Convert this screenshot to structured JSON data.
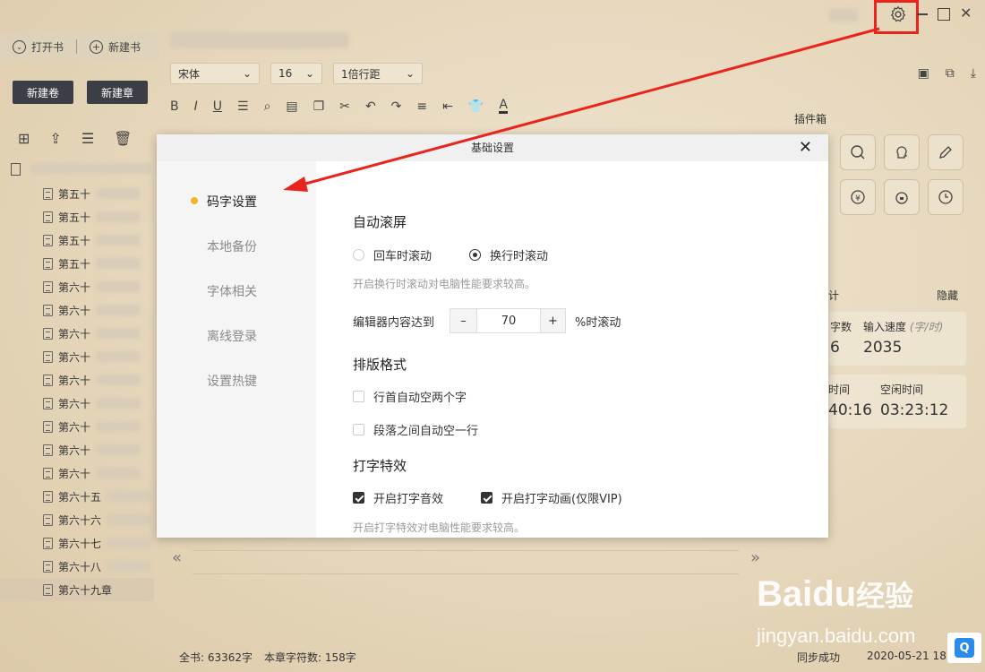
{
  "window": {
    "settings_icon": "gear-icon",
    "minimize": "–",
    "maximize": "☐",
    "close": "✕"
  },
  "left": {
    "open_book": "打开书",
    "new_book": "新建书",
    "new_volume": "新建卷",
    "new_chapter": "新建章",
    "chapters": [
      "第五十",
      "第五十",
      "第五十",
      "第五十",
      "第六十",
      "第六十",
      "第六十",
      "第六十",
      "第六十",
      "第六十",
      "第六十",
      "第六十",
      "第六十",
      "第六十五",
      "第六十六",
      "第六十七",
      "第六十八",
      "第六十九章"
    ]
  },
  "toolbar": {
    "font": "宋体",
    "size": "16",
    "line_spacing": "1倍行距",
    "text_color_icon": "A"
  },
  "plugins": {
    "title": "插件箱",
    "hide": "隐藏",
    "input_speed_label": "输入速度",
    "input_speed_unit": "(字/时)",
    "input_speed_value": "2035",
    "char_count_label": "字数",
    "char_count_value": "6",
    "time_label": "时间",
    "time_value": "40:16",
    "idle_label": "空闲时间",
    "idle_value": "03:23:12",
    "stat_label": "计"
  },
  "editor": {
    "prev": "«",
    "next": "»"
  },
  "status": {
    "total": "全书: 63362字",
    "chapter_count": "本章字符数: 158字",
    "sync": "同步成功",
    "datetime": "2020-05-21 18:"
  },
  "dialog": {
    "title": "基础设置",
    "close": "✕",
    "nav": [
      "码字设置",
      "本地备份",
      "字体相关",
      "离线登录",
      "设置热键"
    ],
    "auto_scroll": {
      "title": "自动滚屏",
      "opt1": "回车时滚动",
      "opt2": "换行时滚动",
      "hint": "开启换行时滚动对电脑性能要求较高。",
      "editor_label": "编辑器内容达到",
      "value": "70",
      "suffix": "%时滚动",
      "minus": "–",
      "plus": "+"
    },
    "format": {
      "title": "排版格式",
      "opt1": "行首自动空两个字",
      "opt2": "段落之间自动空一行"
    },
    "effects": {
      "title": "打字特效",
      "opt1": "开启打字音效",
      "opt2": "开启打字动画(仅限VIP)",
      "hint": "开启打字特效对电脑性能要求较高。"
    }
  },
  "watermark": {
    "brand": "Bai",
    "brand2": "du",
    "brand3": "经验",
    "url": "jingyan.baidu.com"
  }
}
